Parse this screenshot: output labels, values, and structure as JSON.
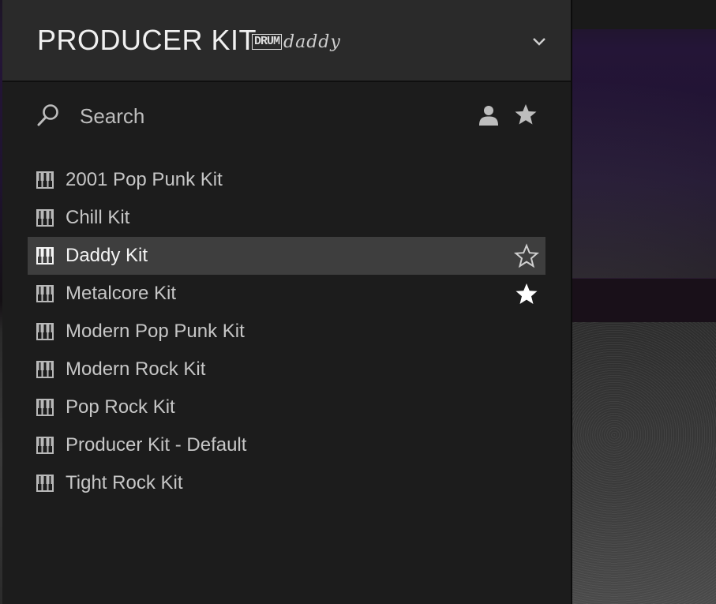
{
  "header": {
    "title": "PRODUCER KIT",
    "logo_text_a": "DRUM",
    "logo_text_b": "daddy"
  },
  "search": {
    "placeholder": "Search"
  },
  "presets": [
    {
      "name": "2001 Pop Punk Kit",
      "selected": false,
      "favorite": false,
      "show_star": false
    },
    {
      "name": "Chill Kit",
      "selected": false,
      "favorite": false,
      "show_star": false
    },
    {
      "name": "Daddy Kit",
      "selected": true,
      "favorite": false,
      "show_star": true
    },
    {
      "name": "Metalcore Kit",
      "selected": false,
      "favorite": true,
      "show_star": true
    },
    {
      "name": "Modern Pop Punk Kit",
      "selected": false,
      "favorite": false,
      "show_star": false
    },
    {
      "name": "Modern Rock Kit",
      "selected": false,
      "favorite": false,
      "show_star": false
    },
    {
      "name": "Pop Rock Kit",
      "selected": false,
      "favorite": false,
      "show_star": false
    },
    {
      "name": "Producer Kit - Default",
      "selected": false,
      "favorite": false,
      "show_star": false
    },
    {
      "name": "Tight Rock Kit",
      "selected": false,
      "favorite": false,
      "show_star": false
    }
  ],
  "icons": {
    "preset": "keyboard-icon",
    "search": "search-icon",
    "user": "user-icon",
    "favorite": "star-icon",
    "dropdown": "chevron-down-icon"
  },
  "colors": {
    "panel_bg": "#1c1c1c",
    "header_bg": "#2a2a2a",
    "selected_row": "#3e3e3e",
    "text": "#c6c6c6"
  }
}
